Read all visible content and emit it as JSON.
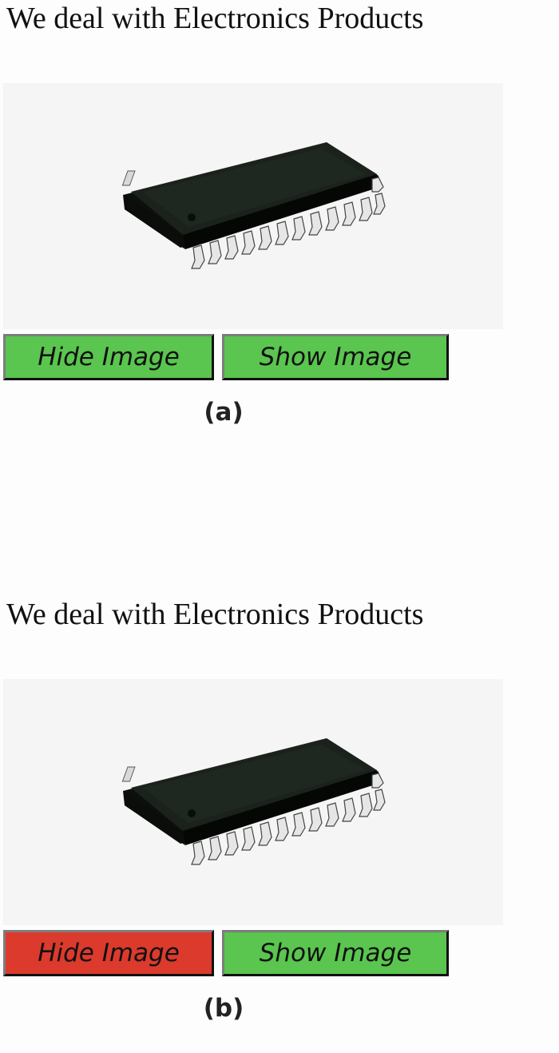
{
  "panels": [
    {
      "heading": "We deal with Electronics Products",
      "hide_button": {
        "label": "Hide Image",
        "color": "#5ac54f"
      },
      "show_button": {
        "label": "Show Image",
        "color": "#5ac54f"
      },
      "caption": "(a)"
    },
    {
      "heading": "We deal with Electronics Products",
      "hide_button": {
        "label": "Hide Image",
        "color": "#db3a2d"
      },
      "show_button": {
        "label": "Show Image",
        "color": "#5ac54f"
      },
      "caption": "(b)"
    }
  ],
  "image_subject": "electronic-chip-photo"
}
